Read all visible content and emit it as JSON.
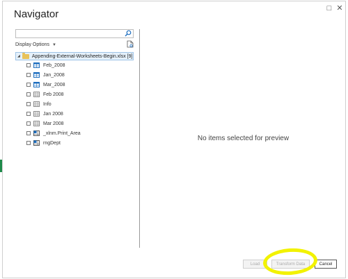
{
  "dialog": {
    "title": "Navigator",
    "window_buttons": [
      "□",
      "✕"
    ]
  },
  "search": {
    "placeholder": "",
    "value": ""
  },
  "display_options_label": "Display Options",
  "tree": {
    "root_label": "Appending-External-Worksheets-Begin.xlsx [9]",
    "items": [
      {
        "label": "Feb_2008",
        "icon": "table-icon"
      },
      {
        "label": "Jan_2008",
        "icon": "table-icon"
      },
      {
        "label": "Mar_2008",
        "icon": "table-icon"
      },
      {
        "label": "Feb 2008",
        "icon": "sheet-icon"
      },
      {
        "label": "Info",
        "icon": "sheet-icon"
      },
      {
        "label": "Jan 2008",
        "icon": "sheet-icon"
      },
      {
        "label": "Mar 2008",
        "icon": "sheet-icon"
      },
      {
        "label": "_xlnm.Print_Area",
        "icon": "named-range-icon"
      },
      {
        "label": "rngDept",
        "icon": "named-range-icon"
      }
    ]
  },
  "preview": {
    "message": "No items selected for preview"
  },
  "footer": {
    "load_label": "Load",
    "transform_label": "Transform Data",
    "cancel_label": "Cancel"
  },
  "colors": {
    "highlight": "#f2f200",
    "table_icon": "#1f6fbf",
    "sheet_icon": "#8a8a8a",
    "folder": "#e8c25a",
    "selection": "#e5f1fb"
  }
}
